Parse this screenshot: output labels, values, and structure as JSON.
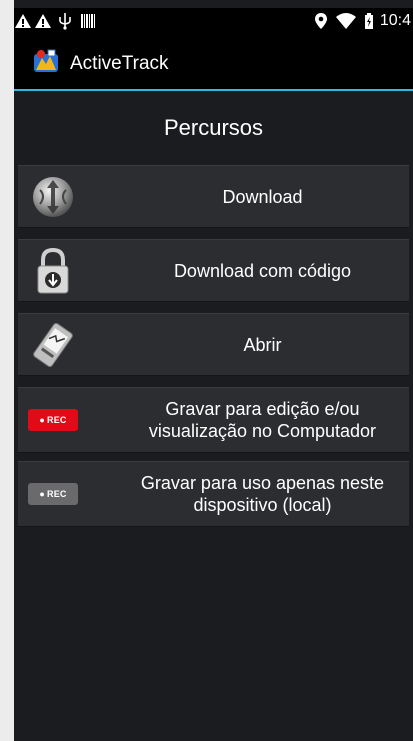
{
  "status_bar": {
    "time": "10:4",
    "icons": [
      "warning-icon",
      "warning-icon",
      "usb-icon",
      "barcode-icon",
      "location-icon",
      "wifi-icon",
      "battery-icon"
    ]
  },
  "app": {
    "title": "ActiveTrack"
  },
  "page": {
    "title": "Percursos"
  },
  "menu": [
    {
      "label": "Download",
      "icon": "sync-globe-icon"
    },
    {
      "label": "Download com código",
      "icon": "padlock-download-icon"
    },
    {
      "label": "Abrir",
      "icon": "gps-device-icon"
    },
    {
      "label": "Gravar para edição e/ou\nvisualização no Computador",
      "icon": "rec-red-icon",
      "badge": "REC"
    },
    {
      "label": "Gravar para uso apenas neste\ndispositivo (local)",
      "icon": "rec-gray-icon",
      "badge": "REC"
    }
  ],
  "colors": {
    "accent": "#33b5e5",
    "rec_red": "#e10b17",
    "rec_gray": "#6a6a6c"
  }
}
